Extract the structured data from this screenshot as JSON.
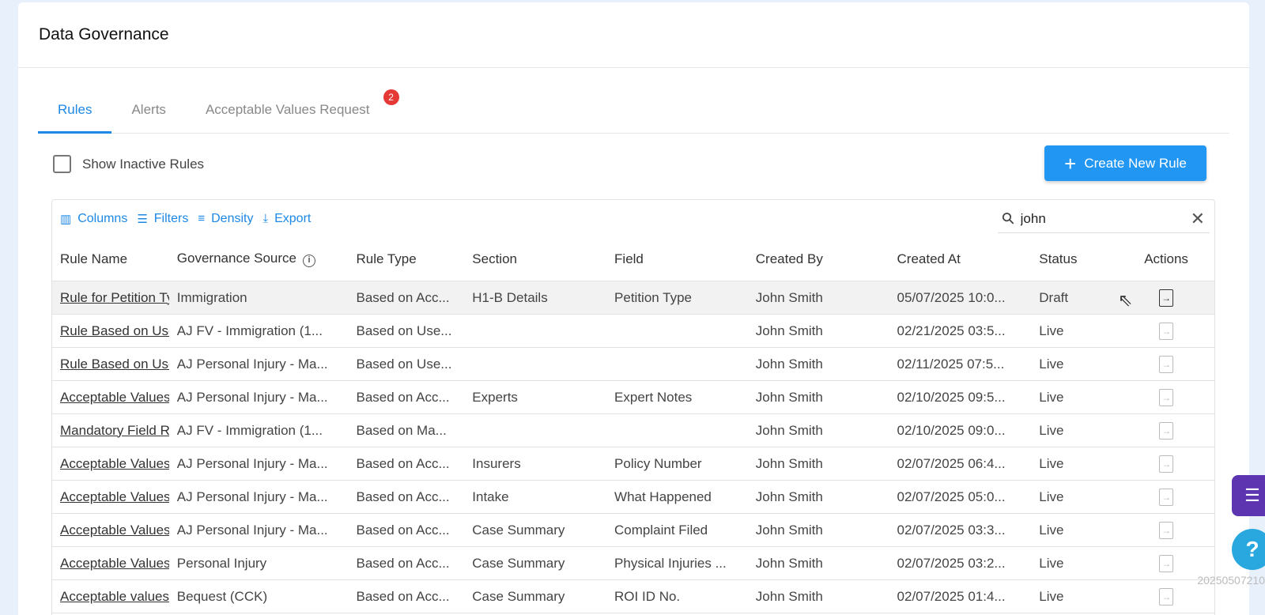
{
  "header": {
    "title": "Data Governance"
  },
  "tabs": [
    {
      "label": "Rules",
      "active": true
    },
    {
      "label": "Alerts",
      "active": false
    },
    {
      "label": "Acceptable Values Request",
      "active": false,
      "badge": "2"
    }
  ],
  "filters": {
    "show_inactive_label": "Show Inactive Rules"
  },
  "actions": {
    "create_label": "Create New Rule"
  },
  "toolbar": {
    "columns": "Columns",
    "filters": "Filters",
    "density": "Density",
    "export": "Export",
    "search_value": "john"
  },
  "table": {
    "headers": [
      "Rule Name",
      "Governance Source",
      "Rule Type",
      "Section",
      "Field",
      "Created By",
      "Created At",
      "Status",
      "Actions"
    ],
    "rows": [
      [
        "Rule for Petition Type",
        "Immigration",
        "Based on Acc...",
        "H1-B Details",
        "Petition Type",
        "John Smith",
        "05/07/2025 10:0...",
        "Draft"
      ],
      [
        "Rule Based on User",
        "AJ FV - Immigration (1...",
        "Based on Use...",
        "",
        "",
        "John Smith",
        "02/21/2025 03:5...",
        "Live"
      ],
      [
        "Rule Based on User",
        "AJ Personal Injury - Ma...",
        "Based on Use...",
        "",
        "",
        "John Smith",
        "02/11/2025 07:5...",
        "Live"
      ],
      [
        "Acceptable Values",
        "AJ Personal Injury - Ma...",
        "Based on Acc...",
        "Experts",
        "Expert Notes",
        "John Smith",
        "02/10/2025 09:5...",
        "Live"
      ],
      [
        "Mandatory Field Rule",
        "AJ FV - Immigration (1...",
        "Based on Ma...",
        "",
        "",
        "John Smith",
        "02/10/2025 09:0...",
        "Live"
      ],
      [
        "Acceptable Values",
        "AJ Personal Injury - Ma...",
        "Based on Acc...",
        "Insurers",
        "Policy Number",
        "John Smith",
        "02/07/2025 06:4...",
        "Live"
      ],
      [
        "Acceptable Values",
        "AJ Personal Injury - Ma...",
        "Based on Acc...",
        "Intake",
        "What Happened",
        "John Smith",
        "02/07/2025 05:0...",
        "Live"
      ],
      [
        "Acceptable Values",
        "AJ Personal Injury - Ma...",
        "Based on Acc...",
        "Case Summary",
        "Complaint Filed",
        "John Smith",
        "02/07/2025 03:3...",
        "Live"
      ],
      [
        "Acceptable Values",
        "Personal Injury",
        "Based on Acc...",
        "Case Summary",
        "Physical Injuries ...",
        "John Smith",
        "02/07/2025 03:2...",
        "Live"
      ],
      [
        "Acceptable values",
        "Bequest (CCK)",
        "Based on Acc...",
        "Case Summary",
        "ROI ID No.",
        "John Smith",
        "02/07/2025 01:4...",
        "Live"
      ]
    ]
  },
  "footer_stamp": "20250507210"
}
